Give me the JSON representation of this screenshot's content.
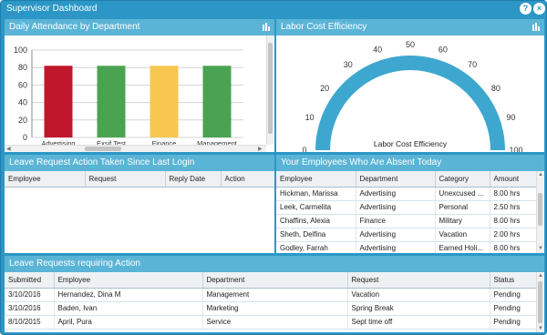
{
  "window": {
    "title": "Supervisor Dashboard",
    "help_label": "?",
    "close_label": "×"
  },
  "attendance": {
    "title": "Daily Attendance by Department",
    "icon": "chart-settings-icon"
  },
  "labor": {
    "title": "Labor Cost Efficiency",
    "icon": "chart-settings-icon",
    "gauge_label": "Labor Cost Efficiency",
    "ticks": [
      "0",
      "10",
      "20",
      "30",
      "40",
      "50",
      "60",
      "70",
      "80",
      "90",
      "100"
    ]
  },
  "leave_actions": {
    "title": "Leave Request Action Taken Since Last Login",
    "columns": [
      "Employee",
      "Request",
      "Reply Date",
      "Action"
    ]
  },
  "absent": {
    "title": "Your Employees Who Are Absent Today",
    "columns": [
      "Employee",
      "Department",
      "Category",
      "Amount"
    ],
    "rows": [
      [
        "Hickman, Marissa",
        "Advertising",
        "Unexcused ...",
        "8.00 hrs"
      ],
      [
        "Leek, Carmelita",
        "Advertising",
        "Personal",
        "2.50 hrs"
      ],
      [
        "Chaffins, Alexia",
        "Finance",
        "Military",
        "8.00 hrs"
      ],
      [
        "Sheth, Delfina",
        "Advertising",
        "Vacation",
        "2.00 hrs"
      ],
      [
        "Godley, Farrah",
        "Advertising",
        "Earned Holi...",
        "8.00 hrs"
      ]
    ]
  },
  "requests": {
    "title": "Leave Requests requiring Action",
    "columns": [
      "Submitted",
      "Employee",
      "Department",
      "Request",
      "Status"
    ],
    "rows": [
      [
        "3/10/2016",
        "Hernandez, Dina M",
        "Management",
        "Vacation",
        "Pending"
      ],
      [
        "3/10/2016",
        "Baden, Ivan",
        "Marketing",
        "Spring Break",
        "Pending"
      ],
      [
        "8/10/2015",
        "April, Pura",
        "Service",
        "Sept time off",
        "Pending"
      ]
    ]
  },
  "chart_data": [
    {
      "type": "bar",
      "title": "Daily Attendance by Department",
      "categories": [
        "Advertising",
        "Exsif Test",
        "Finance",
        "Management"
      ],
      "values": [
        82,
        82,
        82,
        82
      ],
      "colors": [
        "#c1172c",
        "#4aa351",
        "#f8c750",
        "#4aa351"
      ],
      "ylim": [
        0,
        100
      ],
      "yticks": [
        "0",
        "20",
        "40",
        "60",
        "80",
        "100"
      ],
      "grid": true
    },
    {
      "type": "gauge",
      "title": "Labor Cost Efficiency",
      "range": [
        0,
        100
      ],
      "value": 100,
      "color": "#3ea7cf"
    }
  ]
}
